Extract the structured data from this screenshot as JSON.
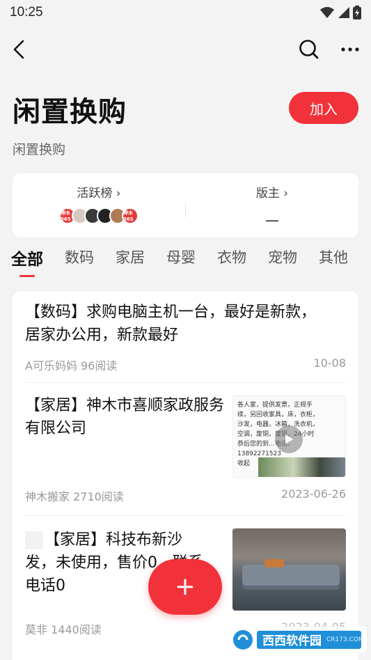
{
  "status_bar": {
    "time": "10:25"
  },
  "header": {
    "back_icon": "chevron-left-icon",
    "search_icon": "search-icon",
    "more_icon": "more-icon"
  },
  "group": {
    "title": "闲置换购",
    "subtitle": "闲置换购",
    "join_label": "加入"
  },
  "info_card": {
    "active_label": "活跃榜 ›",
    "moderator_label": "版主 ›",
    "moderator_value": "—",
    "avatar_labels": [
      "神木 365",
      "",
      "",
      "",
      "",
      "神木 365"
    ]
  },
  "tabs": [
    "全部",
    "数码",
    "家居",
    "母婴",
    "衣物",
    "宠物",
    "其他"
  ],
  "posts": [
    {
      "text": "【数码】求购电脑主机一台，最好是新款，居家办公用，新款最好",
      "meta": "A可乐妈妈 96阅读",
      "date": "10-08"
    },
    {
      "text": "【家居】神木市喜顺家政服务有限公司",
      "meta": "神木搬家 2710阅读",
      "date": "2023-06-26",
      "thumb_lines": [
        "各人家，提供发票，正规手",
        "续，另回收家具，床，衣柜，",
        "沙发，电器，冰箱，洗衣机，",
        "空调，废铜，废铝，24小时",
        "恭后您的到…电话：",
        "13892271523",
        "收起"
      ]
    },
    {
      "text": "【家居】科技布新沙发，未使用，售价0…联系电话0",
      "meta": "莫非 1440阅读",
      "date": "2023-04-05"
    }
  ],
  "fab": {
    "icon": "plus-icon"
  },
  "watermark": {
    "text": "西西软件园",
    "sub": "CR173.COM"
  },
  "colors": {
    "accent": "#f1323b",
    "background": "#f3f3f3"
  }
}
